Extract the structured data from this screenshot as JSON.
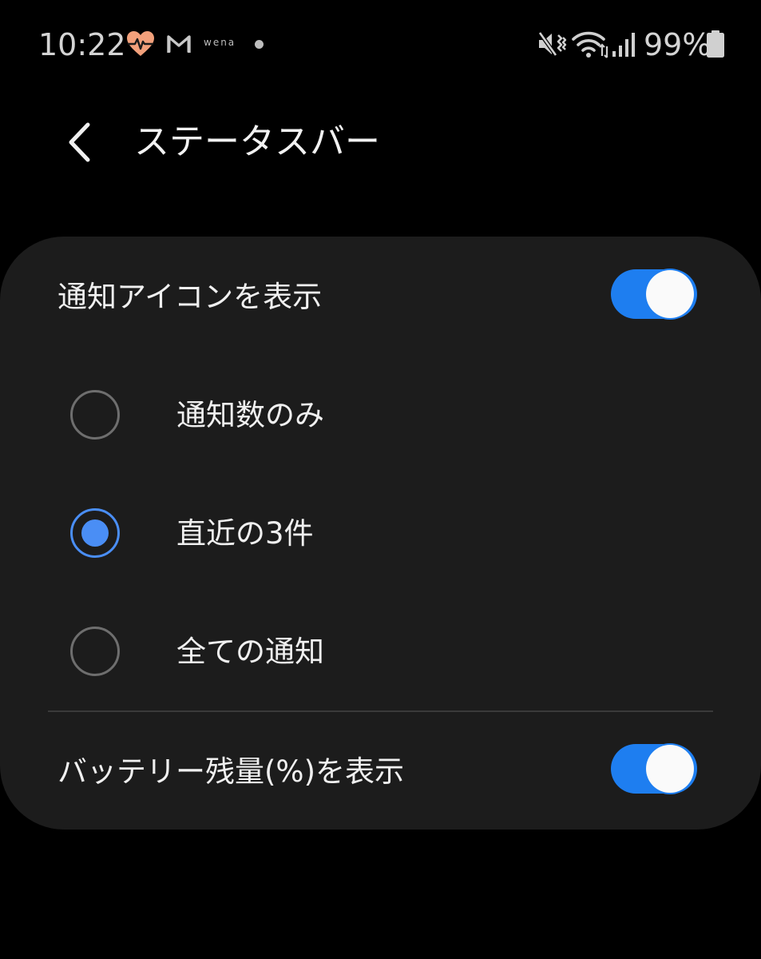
{
  "status_bar": {
    "time": "10:22",
    "wena_label": "wena",
    "battery_percent": "99%",
    "icons": [
      "heart-rate-icon",
      "gmail-icon",
      "wena-icon",
      "dot-icon",
      "mute-vibrate-icon",
      "wifi-icon",
      "signal-icon",
      "battery-icon"
    ],
    "heart_color": "#f2a07b"
  },
  "header": {
    "title": "ステータスバー",
    "back_icon": "chevron-left-icon"
  },
  "settings": {
    "notification_icons": {
      "label": "通知アイコンを表示",
      "enabled": true
    },
    "options": [
      {
        "label": "通知数のみ",
        "selected": false
      },
      {
        "label": "直近の3件",
        "selected": true
      },
      {
        "label": "全ての通知",
        "selected": false
      }
    ],
    "battery_percentage": {
      "label": "バッテリー残量(%)を表示",
      "enabled": true
    }
  },
  "colors": {
    "accent": "#1e7ef0",
    "radio_selected": "#4a8ef5",
    "card_background": "#1c1c1c",
    "page_background": "#000000"
  }
}
